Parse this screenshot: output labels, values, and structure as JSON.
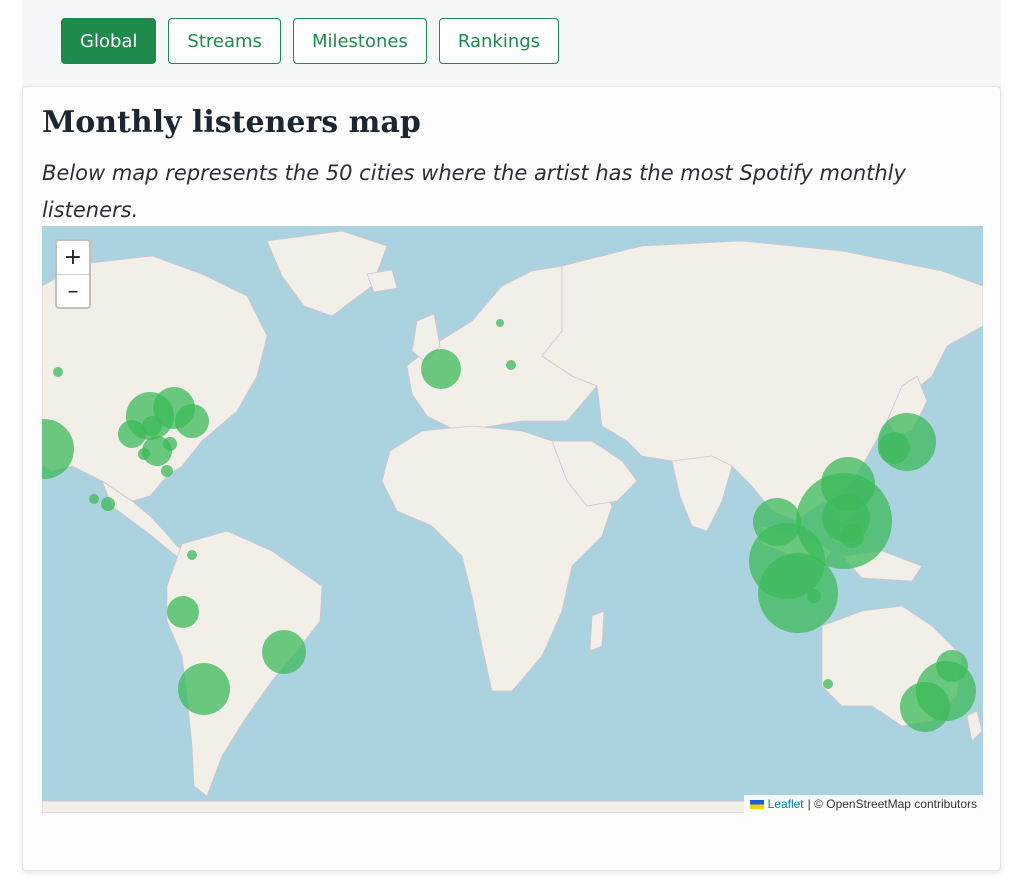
{
  "nav": {
    "tabs": [
      {
        "label": "Global",
        "active": true
      },
      {
        "label": "Streams",
        "active": false
      },
      {
        "label": "Milestones",
        "active": false
      },
      {
        "label": "Rankings",
        "active": false
      }
    ]
  },
  "card": {
    "title": "Monthly listeners map",
    "subtitle": "Below map represents the 50 cities where the artist has the most Spotify monthly listeners."
  },
  "map": {
    "zoom_in_label": "+",
    "zoom_out_label": "–",
    "attribution": {
      "leaflet_link": "Leaflet",
      "text": "| © OpenStreetMap contributors"
    },
    "colors": {
      "water": "#aad3df",
      "land": "#f2efe9",
      "marker": "#3cb95a"
    }
  }
}
